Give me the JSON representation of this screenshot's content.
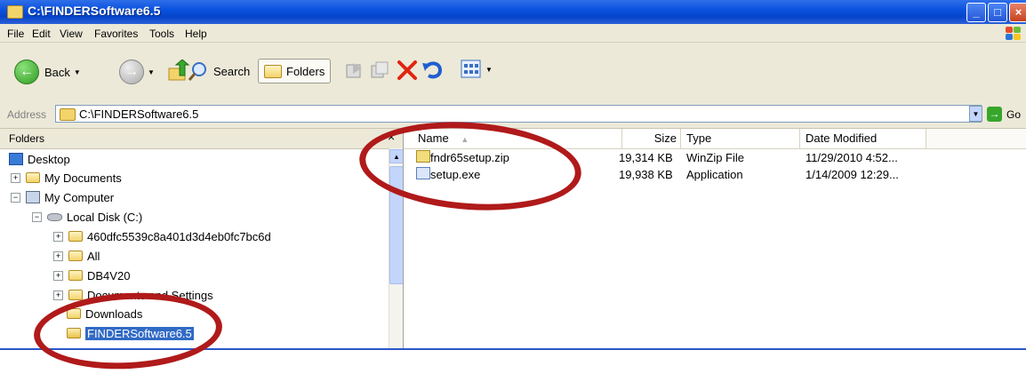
{
  "window": {
    "title": "C:\\FINDERSoftware6.5"
  },
  "menu": [
    {
      "label": "File"
    },
    {
      "label": "Edit"
    },
    {
      "label": "View"
    },
    {
      "label": "Favorites"
    },
    {
      "label": "Tools"
    },
    {
      "label": "Help"
    }
  ],
  "toolbar": {
    "back_label": "Back",
    "search_label": "Search",
    "folders_label": "Folders"
  },
  "address": {
    "label": "Address",
    "value": "C:\\FINDERSoftware6.5",
    "go_label": "Go"
  },
  "folders_pane": {
    "header": "Folders",
    "close_glyph": "×",
    "tree": [
      {
        "label": "Desktop"
      },
      {
        "label": "My Documents"
      },
      {
        "label": "My Computer"
      },
      {
        "label": "Local Disk (C:)"
      },
      {
        "label": "460dfc5539c8a401d3d4eb0fc7bc6d"
      },
      {
        "label": "All"
      },
      {
        "label": "DB4V20"
      },
      {
        "label": "Documents and Settings"
      },
      {
        "label": "Downloads"
      },
      {
        "label": "FINDERSoftware6.5"
      }
    ]
  },
  "files_pane": {
    "columns": {
      "name": "Name",
      "size": "Size",
      "type": "Type",
      "date": "Date Modified"
    },
    "files": [
      {
        "name": "fndr65setup.zip",
        "size": "19,314 KB",
        "type": "WinZip File",
        "date": "11/29/2010 4:52..."
      },
      {
        "name": "setup.exe",
        "size": "19,938 KB",
        "type": "Application",
        "date": "1/14/2009 12:29..."
      }
    ]
  },
  "colors": {
    "titlebar": "#0a52df",
    "selection": "#316ac5",
    "annotation": "#b01a1a"
  }
}
